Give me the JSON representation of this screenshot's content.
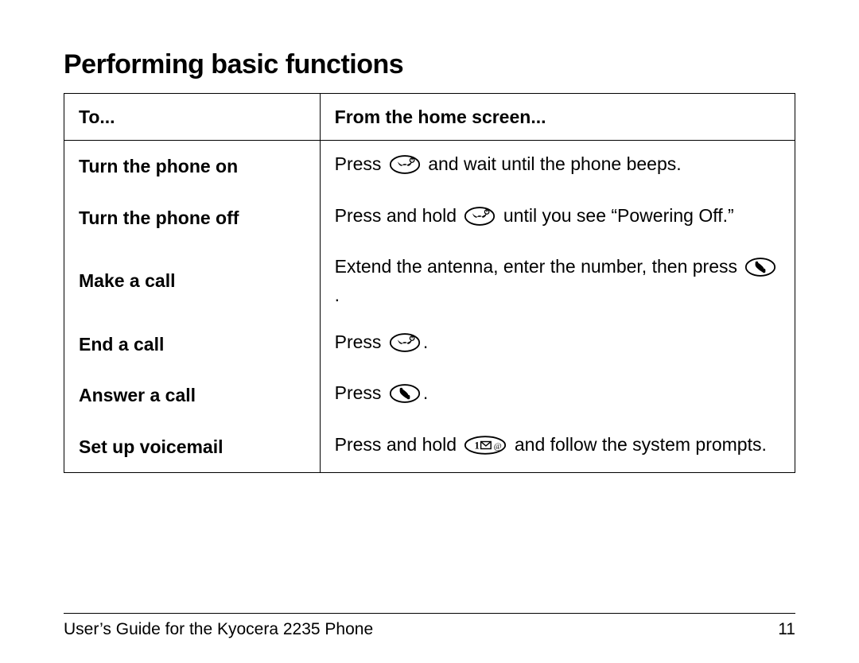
{
  "title": "Performing basic functions",
  "headers": {
    "to": "To...",
    "from": "From the home screen..."
  },
  "rows": [
    {
      "task": "Turn the phone on",
      "parts": [
        {
          "type": "text",
          "value": "Press "
        },
        {
          "type": "icon",
          "icon": "power-end"
        },
        {
          "type": "text",
          "value": " and wait until the phone beeps."
        }
      ]
    },
    {
      "task": "Turn the phone off",
      "parts": [
        {
          "type": "text",
          "value": "Press and hold "
        },
        {
          "type": "icon",
          "icon": "power-end"
        },
        {
          "type": "text",
          "value": " until you see “Powering Off.”"
        }
      ]
    },
    {
      "task": "Make a call",
      "parts": [
        {
          "type": "text",
          "value": "Extend the antenna, enter the number, then press "
        },
        {
          "type": "icon",
          "icon": "talk"
        },
        {
          "type": "text",
          "value": "."
        }
      ]
    },
    {
      "task": "End a call",
      "parts": [
        {
          "type": "text",
          "value": "Press "
        },
        {
          "type": "icon",
          "icon": "power-end"
        },
        {
          "type": "text",
          "value": "."
        }
      ]
    },
    {
      "task": "Answer a call",
      "parts": [
        {
          "type": "text",
          "value": "Press "
        },
        {
          "type": "icon",
          "icon": "talk"
        },
        {
          "type": "text",
          "value": "."
        }
      ]
    },
    {
      "task": "Set up voicemail",
      "parts": [
        {
          "type": "text",
          "value": "Press and hold "
        },
        {
          "type": "icon",
          "icon": "voicemail"
        },
        {
          "type": "text",
          "value": " and follow the system prompts."
        }
      ]
    }
  ],
  "footer": {
    "left": "User’s Guide for the Kyocera 2235 Phone",
    "right": "11"
  }
}
